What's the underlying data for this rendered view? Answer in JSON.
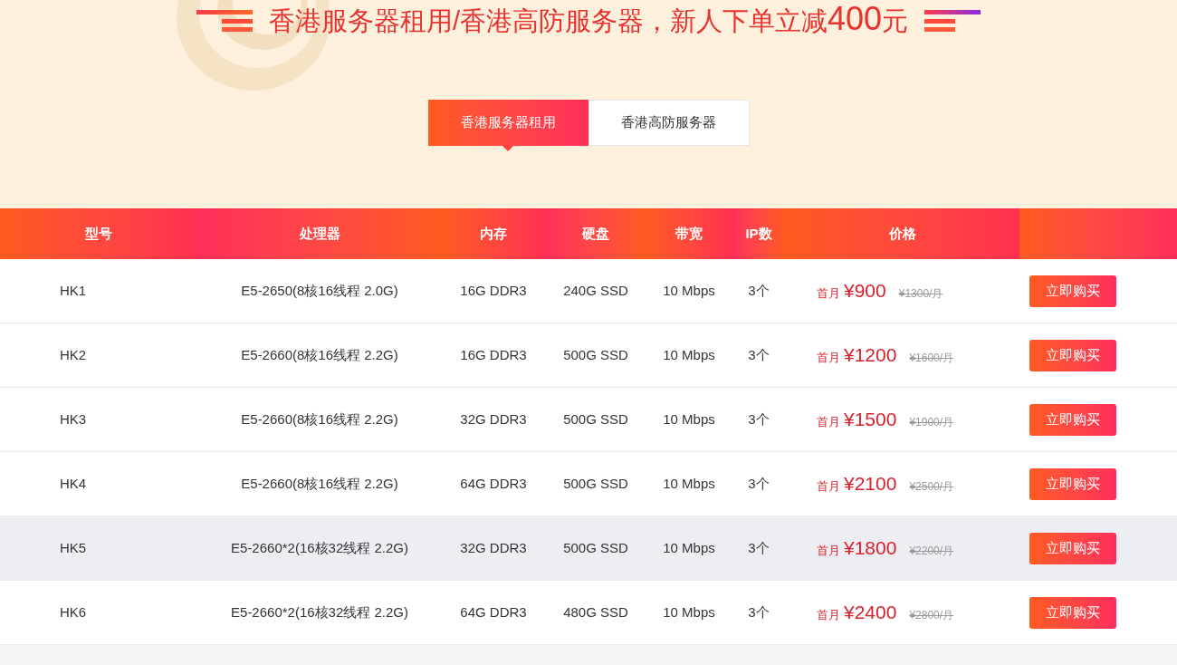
{
  "banner": {
    "title": "香港服务器租用/香港高防服务器，新人下单立减",
    "title_amount": "400",
    "title_unit": "元"
  },
  "tabs": [
    {
      "label": "香港服务器租用",
      "selected": true
    },
    {
      "label": "香港高防服务器",
      "selected": false
    }
  ],
  "table": {
    "columns": [
      "型号",
      "处理器",
      "内存",
      "硬盘",
      "带宽",
      "IP数",
      "价格"
    ],
    "rows": [
      {
        "model": "HK1",
        "cpu": "E5-2650(8核16线程 2.0G)",
        "ram": "16G DDR3",
        "disk": "240G SSD",
        "bandwidth": "10 Mbps",
        "ips": "3个",
        "first_month": "首月",
        "price": "¥900",
        "original": "¥1300/月",
        "button": "立即购买",
        "highlighted": false
      },
      {
        "model": "HK2",
        "cpu": "E5-2660(8核16线程 2.2G)",
        "ram": "16G DDR3",
        "disk": "500G SSD",
        "bandwidth": "10 Mbps",
        "ips": "3个",
        "first_month": "首月",
        "price": "¥1200",
        "original": "¥1600/月",
        "button": "立即购买",
        "highlighted": false
      },
      {
        "model": "HK3",
        "cpu": "E5-2660(8核16线程 2.2G)",
        "ram": "32G DDR3",
        "disk": "500G SSD",
        "bandwidth": "10 Mbps",
        "ips": "3个",
        "first_month": "首月",
        "price": "¥1500",
        "original": "¥1900/月",
        "button": "立即购买",
        "highlighted": false
      },
      {
        "model": "HK4",
        "cpu": "E5-2660(8核16线程 2.2G)",
        "ram": "64G DDR3",
        "disk": "500G SSD",
        "bandwidth": "10 Mbps",
        "ips": "3个",
        "first_month": "首月",
        "price": "¥2100",
        "original": "¥2500/月",
        "button": "立即购买",
        "highlighted": false
      },
      {
        "model": "HK5",
        "cpu": "E5-2660*2(16核32线程 2.2G)",
        "ram": "32G DDR3",
        "disk": "500G SSD",
        "bandwidth": "10 Mbps",
        "ips": "3个",
        "first_month": "首月",
        "price": "¥1800",
        "original": "¥2200/月",
        "button": "立即购买",
        "highlighted": true
      },
      {
        "model": "HK6",
        "cpu": "E5-2660*2(16核32线程 2.2G)",
        "ram": "64G DDR3",
        "disk": "480G SSD",
        "bandwidth": "10 Mbps",
        "ips": "3个",
        "first_month": "首月",
        "price": "¥2400",
        "original": "¥2800/月",
        "button": "立即购买",
        "highlighted": false
      }
    ]
  }
}
